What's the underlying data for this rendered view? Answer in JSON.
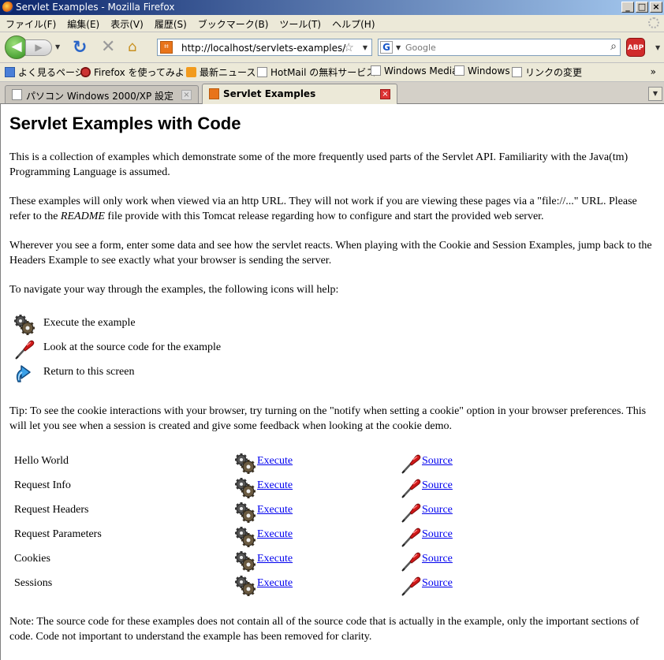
{
  "window": {
    "title": "Servlet Examples - Mozilla Firefox"
  },
  "menu": [
    "ファイル(F)",
    "編集(E)",
    "表示(V)",
    "履歴(S)",
    "ブックマーク(B)",
    "ツール(T)",
    "ヘルプ(H)"
  ],
  "nav": {
    "url": "http://localhost/servlets-examples/",
    "search_placeholder": "Google",
    "search_engine_icon": "G",
    "abp_label": "ABP"
  },
  "bookmarks": [
    "よく見るページ",
    "Firefox を使ってみよう",
    "最新ニュース",
    "HotMail の無料サービス",
    "Windows Media",
    "Windows",
    "リンクの変更"
  ],
  "bookmarks_overflow": "»",
  "tabs": [
    {
      "label": "パソコン Windows 2000/XP 設定",
      "active": false
    },
    {
      "label": "Servlet Examples",
      "active": true
    }
  ],
  "page": {
    "heading": "Servlet Examples with Code",
    "intro": "This is a collection of examples which demonstrate some of the more frequently used parts of the Servlet API. Familiarity with the Java(tm) Programming Language is assumed.",
    "http_note_1": "These examples will only work when viewed via an http URL. They will not work if you are viewing these pages via a \"file://...\" URL. Please refer to the ",
    "readme": "README",
    "http_note_2": " file provide with this Tomcat release regarding how to configure and start the provided web server.",
    "form_note": "Wherever you see a form, enter some data and see how the servlet reacts. When playing with the Cookie and Session Examples, jump back to the Headers Example to see exactly what your browser is sending the server.",
    "navigate_note": "To navigate your way through the examples, the following icons will help:",
    "legend": {
      "execute": "Execute the example",
      "source": "Look at the source code for the example",
      "return": "Return to this screen"
    },
    "tip": "Tip: To see the cookie interactions with your browser, try turning on the \"notify when setting a cookie\" option in your browser preferences. This will let you see when a session is created and give some feedback when looking at the cookie demo.",
    "examples": [
      {
        "name": "Hello World",
        "execute": "Execute",
        "source": "Source"
      },
      {
        "name": "Request Info",
        "execute": "Execute",
        "source": "Source"
      },
      {
        "name": "Request Headers",
        "execute": "Execute",
        "source": "Source"
      },
      {
        "name": "Request Parameters",
        "execute": "Execute",
        "source": "Source"
      },
      {
        "name": "Cookies",
        "execute": "Execute",
        "source": "Source"
      },
      {
        "name": "Sessions",
        "execute": "Execute",
        "source": "Source"
      }
    ],
    "footer_note": "Note: The source code for these examples does not contain all of the source code that is actually in the example, only the important sections of code. Code not important to understand the example has been removed for clarity."
  }
}
